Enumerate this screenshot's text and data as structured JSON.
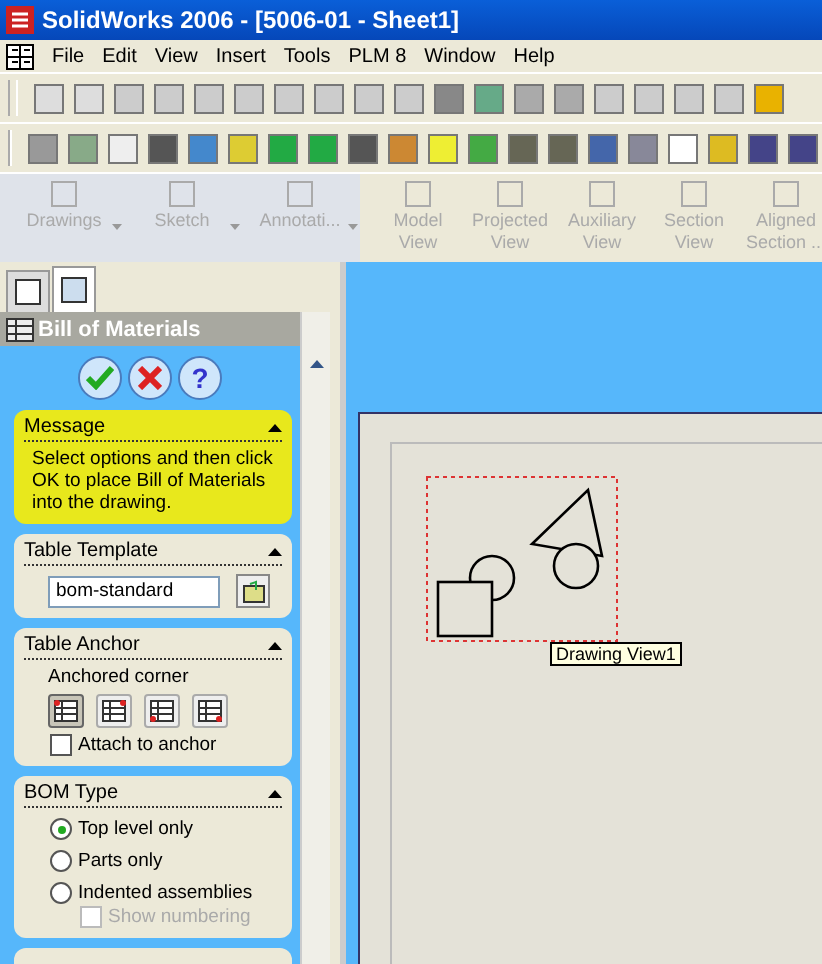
{
  "window": {
    "title": "SolidWorks 2006 - [5006-01 - Sheet1]"
  },
  "menu": [
    "File",
    "Edit",
    "View",
    "Insert",
    "Tools",
    "PLM 8",
    "Window",
    "Help"
  ],
  "command_manager": [
    {
      "label": "Drawings",
      "dropdown": true,
      "disabled": true
    },
    {
      "label": "Sketch",
      "dropdown": true,
      "disabled": true
    },
    {
      "label": "Annotati...",
      "dropdown": true,
      "disabled": true
    },
    {
      "label": "Model View",
      "dropdown": false,
      "disabled": true
    },
    {
      "label": "Projected View",
      "dropdown": false,
      "disabled": true
    },
    {
      "label": "Auxiliary View",
      "dropdown": false,
      "disabled": true
    },
    {
      "label": "Section View",
      "dropdown": false,
      "disabled": true
    },
    {
      "label": "Aligned Section ...",
      "dropdown": false,
      "disabled": true
    }
  ],
  "panel": {
    "tabs": [
      {
        "selected": false
      },
      {
        "selected": true
      }
    ],
    "title": "Bill of Materials",
    "help_button": "?",
    "message": {
      "title": "Message",
      "text": "Select options and then click OK to place Bill of Materials into the drawing."
    },
    "table_template": {
      "title": "Table Template",
      "value": "bom-standard"
    },
    "table_anchor": {
      "title": "Table Anchor",
      "label": "Anchored corner",
      "corners": [
        {
          "selected": true
        },
        {
          "selected": false
        },
        {
          "selected": false
        },
        {
          "selected": false
        }
      ],
      "attach": {
        "label": "Attach to anchor",
        "checked": false
      }
    },
    "bom_type": {
      "title": "BOM Type",
      "options": [
        {
          "label": "Top level only",
          "selected": true
        },
        {
          "label": "Parts only",
          "selected": false
        },
        {
          "label": "Indented assemblies",
          "selected": false
        }
      ],
      "show_numbering": {
        "label": "Show numbering",
        "checked": false,
        "disabled": true
      }
    }
  },
  "drawing": {
    "tooltip": "Drawing View1"
  }
}
